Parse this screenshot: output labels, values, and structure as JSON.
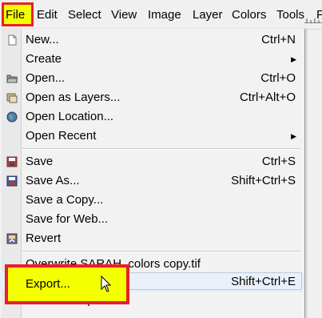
{
  "menubar": {
    "items": [
      {
        "label": "File"
      },
      {
        "label": "Edit"
      },
      {
        "label": "Select"
      },
      {
        "label": "View"
      },
      {
        "label": "Image"
      },
      {
        "label": "Layer"
      },
      {
        "label": "Colors"
      },
      {
        "label": "Tools"
      },
      {
        "label": "F"
      }
    ]
  },
  "file_menu": {
    "items": [
      {
        "label": "New...",
        "shortcut": "Ctrl+N",
        "icon": "new-document-icon"
      },
      {
        "label": "Create",
        "submenu": true
      },
      {
        "label": "Open...",
        "shortcut": "Ctrl+O",
        "icon": "open-folder-icon"
      },
      {
        "label": "Open as Layers...",
        "shortcut": "Ctrl+Alt+O",
        "icon": "open-layers-icon"
      },
      {
        "label": "Open Location...",
        "icon": "globe-icon"
      },
      {
        "label": "Open Recent",
        "submenu": true
      },
      {
        "label": "Save",
        "shortcut": "Ctrl+S",
        "icon": "save-icon"
      },
      {
        "label": "Save As...",
        "shortcut": "Shift+Ctrl+S",
        "icon": "save-as-icon"
      },
      {
        "label": "Save a Copy..."
      },
      {
        "label": "Save for Web..."
      },
      {
        "label": "Revert",
        "icon": "revert-icon"
      },
      {
        "label": "Overwrite SARAH_colors copy.tif"
      },
      {
        "label": "Export...",
        "shortcut": "Shift+Ctrl+E"
      },
      {
        "label": "Create Template..."
      }
    ]
  },
  "colors": {
    "highlight_yellow": "#f4ff00",
    "highlight_red": "#e8202a"
  }
}
